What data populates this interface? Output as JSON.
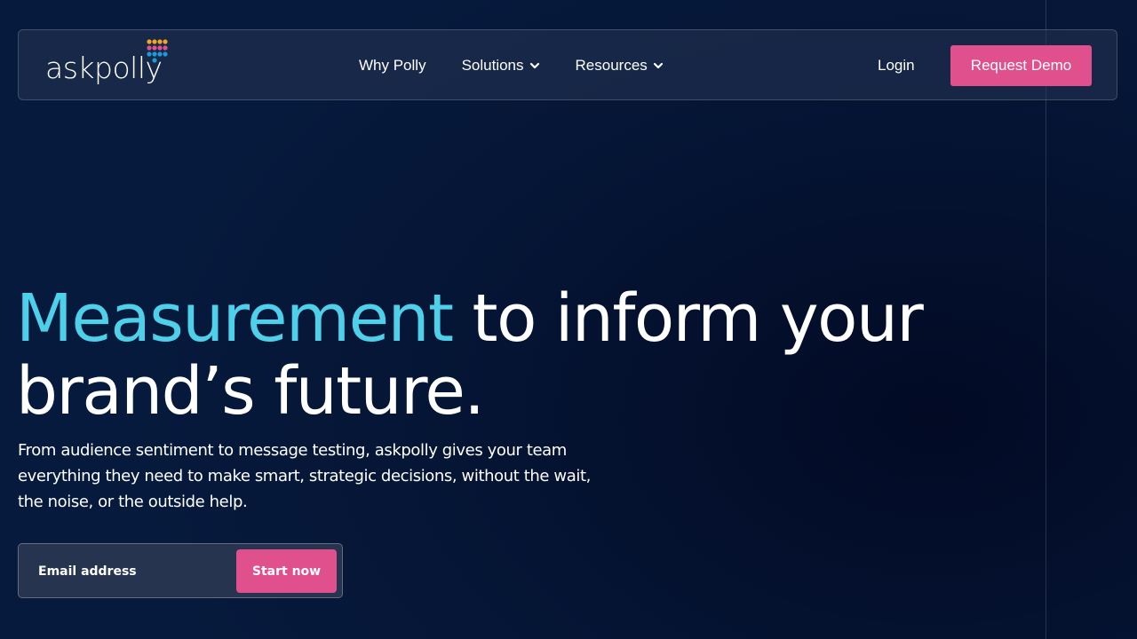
{
  "header": {
    "logo_text": "askpolly",
    "logo_dot_colors": [
      "#f4a424",
      "#e0508d",
      "#1e9ad6",
      "#4fd0ea"
    ],
    "nav": [
      {
        "label": "Why Polly"
      },
      {
        "label": "Solutions",
        "icon": "chevron-down-icon"
      },
      {
        "label": "Resources",
        "icon": "chevron-down-icon"
      }
    ],
    "login_label": "Login",
    "demo_label": "Request Demo"
  },
  "hero": {
    "title_accent": "Measurement",
    "title_rest": " to inform your brand’s future.",
    "subtitle": "From audience sentiment to message testing, askpolly gives your team everything they need to make smart, strategic decisions, without the wait, the noise, or the outside help.",
    "email_placeholder": "Email address",
    "cta_label": "Start now"
  },
  "colors": {
    "accent": "#4fd0ea",
    "brand_pink": "#e0508d",
    "background": "#051433"
  }
}
